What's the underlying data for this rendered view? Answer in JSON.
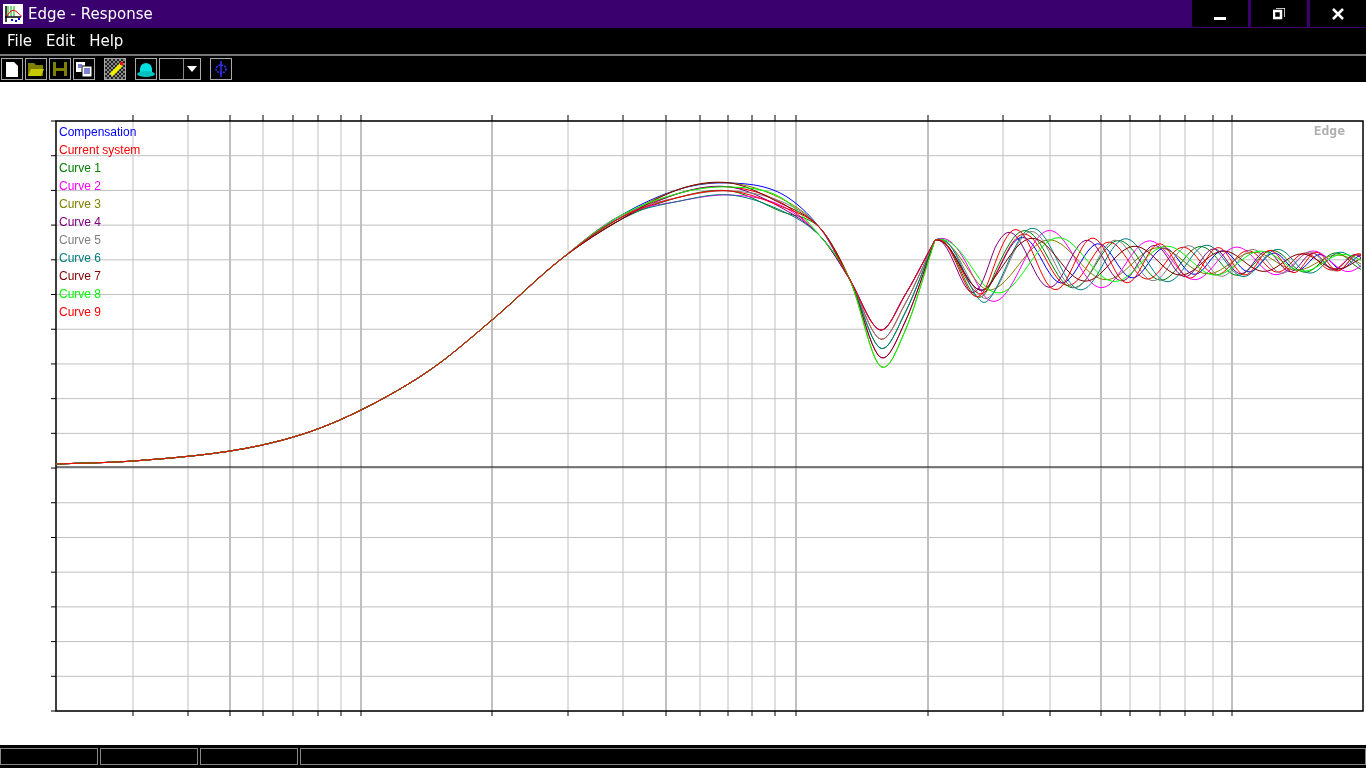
{
  "window": {
    "title": "Edge - Response"
  },
  "menu": [
    "File",
    "Edit",
    "Help"
  ],
  "plot": {
    "label": "Edge",
    "legend": [
      {
        "label": "Compensation",
        "color": "#0000ff"
      },
      {
        "label": "Current system",
        "color": "#ff0000"
      },
      {
        "label": "Curve 1",
        "color": "#008000"
      },
      {
        "label": "Curve 2",
        "color": "#ff00ff"
      },
      {
        "label": "Curve 3",
        "color": "#808000"
      },
      {
        "label": "Curve 4",
        "color": "#800080"
      },
      {
        "label": "Curve 5",
        "color": "#808080"
      },
      {
        "label": "Curve 6",
        "color": "#008080"
      },
      {
        "label": "Curve 7",
        "color": "#800000"
      },
      {
        "label": "Curve 8",
        "color": "#00ff00"
      },
      {
        "label": "Curve 9",
        "color": "#ff0000"
      }
    ]
  }
}
